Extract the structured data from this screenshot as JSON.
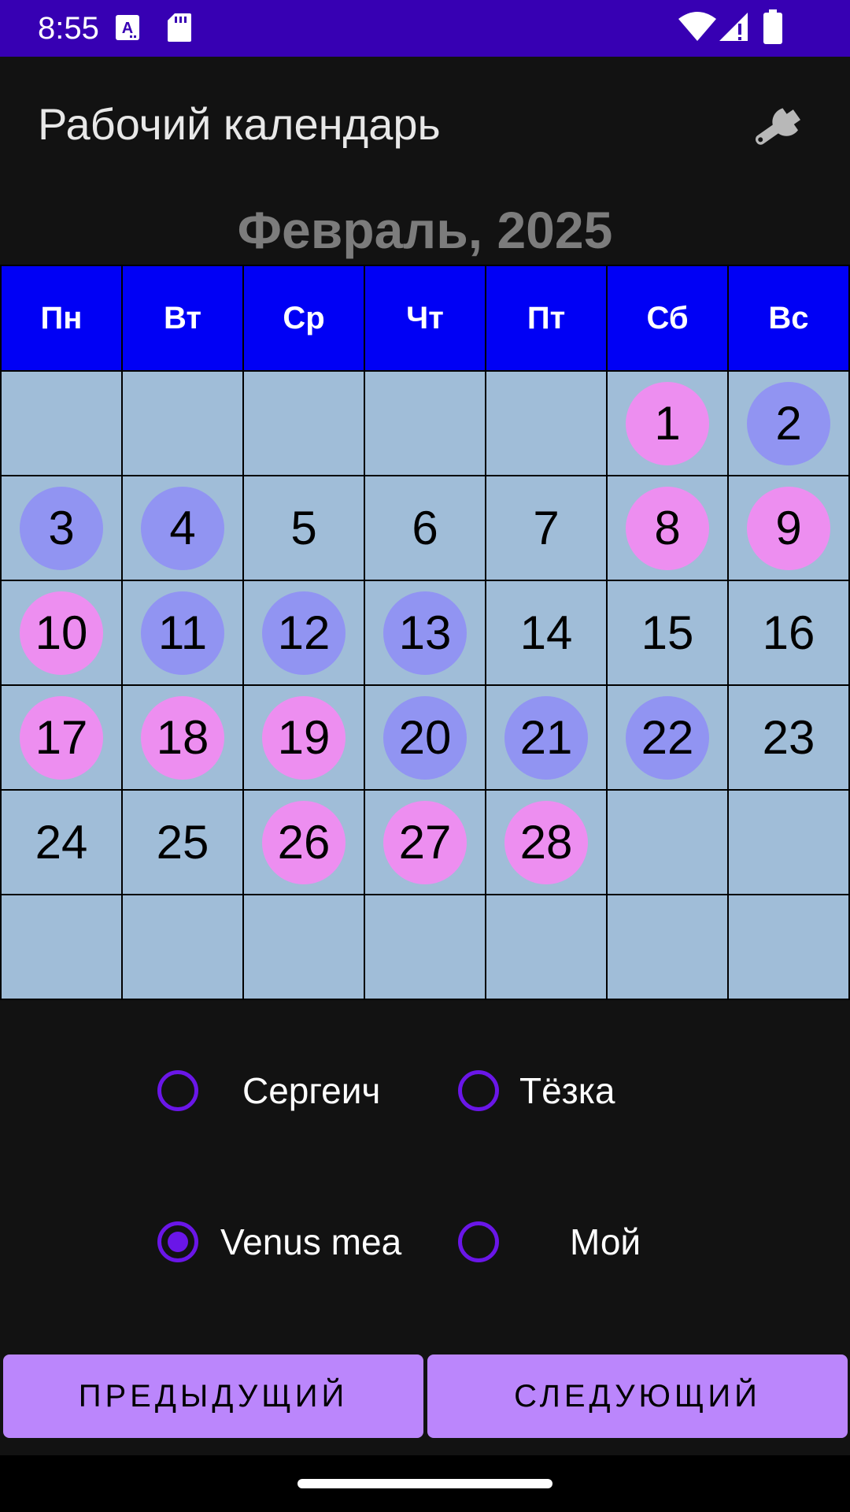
{
  "status_bar": {
    "time": "8:55",
    "icons": [
      "text-a-icon",
      "sd-card-icon",
      "wifi-icon",
      "signal-icon",
      "battery-icon"
    ]
  },
  "app": {
    "title": "Рабочий календарь",
    "settings_icon": "wrench-icon"
  },
  "calendar": {
    "month_title": "Февраль, 2025",
    "weekdays": [
      "Пн",
      "Вт",
      "Ср",
      "Чт",
      "Пт",
      "Сб",
      "Вс"
    ],
    "colors": {
      "header": "#0000f5",
      "cell": "#a0bdd8",
      "pink": "#ed8ef0",
      "blue": "#9194f2"
    },
    "weeks": [
      [
        {
          "d": ""
        },
        {
          "d": ""
        },
        {
          "d": ""
        },
        {
          "d": ""
        },
        {
          "d": ""
        },
        {
          "d": "1",
          "c": "pink"
        },
        {
          "d": "2",
          "c": "blue"
        }
      ],
      [
        {
          "d": "3",
          "c": "blue"
        },
        {
          "d": "4",
          "c": "blue"
        },
        {
          "d": "5"
        },
        {
          "d": "6"
        },
        {
          "d": "7"
        },
        {
          "d": "8",
          "c": "pink"
        },
        {
          "d": "9",
          "c": "pink"
        }
      ],
      [
        {
          "d": "10",
          "c": "pink"
        },
        {
          "d": "11",
          "c": "blue"
        },
        {
          "d": "12",
          "c": "blue"
        },
        {
          "d": "13",
          "c": "blue"
        },
        {
          "d": "14"
        },
        {
          "d": "15"
        },
        {
          "d": "16"
        }
      ],
      [
        {
          "d": "17",
          "c": "pink"
        },
        {
          "d": "18",
          "c": "pink"
        },
        {
          "d": "19",
          "c": "pink"
        },
        {
          "d": "20",
          "c": "blue"
        },
        {
          "d": "21",
          "c": "blue"
        },
        {
          "d": "22",
          "c": "blue"
        },
        {
          "d": "23"
        }
      ],
      [
        {
          "d": "24"
        },
        {
          "d": "25"
        },
        {
          "d": "26",
          "c": "pink"
        },
        {
          "d": "27",
          "c": "pink"
        },
        {
          "d": "28",
          "c": "pink"
        },
        {
          "d": ""
        },
        {
          "d": ""
        }
      ],
      [
        {
          "d": ""
        },
        {
          "d": ""
        },
        {
          "d": ""
        },
        {
          "d": ""
        },
        {
          "d": ""
        },
        {
          "d": ""
        },
        {
          "d": ""
        }
      ]
    ]
  },
  "profiles": {
    "options": [
      {
        "label": "Сергеич",
        "selected": false
      },
      {
        "label": "Тёзка",
        "selected": false
      },
      {
        "label": "Venus mea",
        "selected": true
      },
      {
        "label": "Мой",
        "selected": false
      }
    ]
  },
  "buttons": {
    "prev_label": "ПРЕДЫДУЩИЙ",
    "next_label": "СЛЕДУЮЩИЙ"
  }
}
